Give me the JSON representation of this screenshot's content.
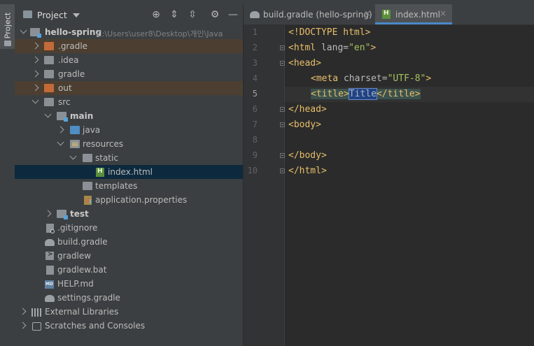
{
  "toolwindow": {
    "vertical_tab": "Project"
  },
  "project_panel": {
    "title": "Project",
    "toolbar_icons": [
      "locate-icon",
      "expand-all-icon",
      "collapse-all-icon",
      "settings-icon",
      "minimize-icon"
    ]
  },
  "tree": {
    "root": {
      "label": "hello-spring",
      "path": "C:\\Users\\user8\\Desktop\\개인\\Java"
    },
    "items": [
      {
        "label": ".gradle"
      },
      {
        "label": ".idea"
      },
      {
        "label": "gradle"
      },
      {
        "label": "out"
      },
      {
        "label": "src"
      },
      {
        "label": "main"
      },
      {
        "label": "java"
      },
      {
        "label": "resources"
      },
      {
        "label": "static"
      },
      {
        "label": "index.html"
      },
      {
        "label": "templates"
      },
      {
        "label": "application.properties"
      },
      {
        "label": "test"
      },
      {
        "label": ".gitignore"
      },
      {
        "label": "build.gradle"
      },
      {
        "label": "gradlew"
      },
      {
        "label": "gradlew.bat"
      },
      {
        "label": "HELP.md"
      },
      {
        "label": "settings.gradle"
      },
      {
        "label": "External Libraries"
      },
      {
        "label": "Scratches and Consoles"
      }
    ]
  },
  "editor": {
    "tabs": [
      {
        "label": "build.gradle (hello-spring)",
        "close": "×"
      },
      {
        "label": "index.html",
        "close": "×"
      }
    ],
    "active_tab": "index.html",
    "current_line": 5,
    "line_numbers": [
      "1",
      "2",
      "3",
      "4",
      "5",
      "6",
      "7",
      "8",
      "9",
      "10"
    ],
    "code": {
      "l1": "<!DOCTYPE html>",
      "l2_open": "<html ",
      "l2_attr": "lang=",
      "l2_str": "\"en\"",
      "l2_close": ">",
      "l3": "<head>",
      "l4_open": "<meta ",
      "l4_attr": "charset=",
      "l4_str": "\"UTF-8\"",
      "l4_close": ">",
      "l5_open": "<title>",
      "l5_text": "Title",
      "l5_close": "</title>",
      "l6": "</head>",
      "l7": "<body>",
      "l9": "</body>",
      "l10": "</html>"
    }
  },
  "colors": {
    "panel_bg": "#3c3f41",
    "editor_bg": "#2b2b2b",
    "selection": "#0d293e",
    "excluded_folder": "#c36a38",
    "tag": "#e8bf6a",
    "string": "#a5c25c",
    "accent": "#4a88c7"
  }
}
